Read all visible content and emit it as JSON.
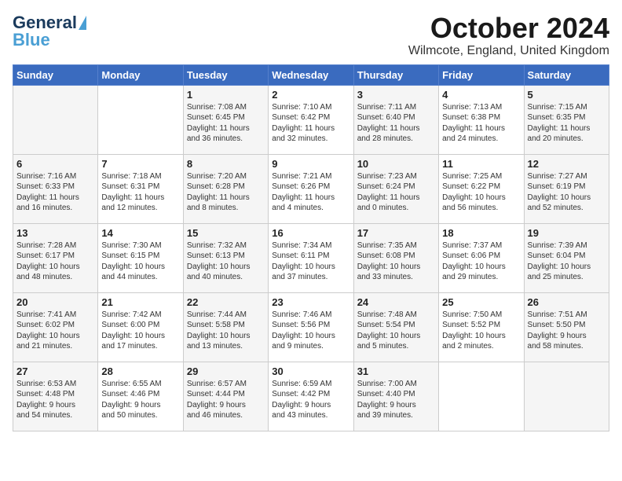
{
  "header": {
    "logo_line1": "General",
    "logo_line2": "Blue",
    "month": "October 2024",
    "location": "Wilmcote, England, United Kingdom"
  },
  "days_of_week": [
    "Sunday",
    "Monday",
    "Tuesday",
    "Wednesday",
    "Thursday",
    "Friday",
    "Saturday"
  ],
  "weeks": [
    [
      {
        "day": "",
        "content": ""
      },
      {
        "day": "",
        "content": ""
      },
      {
        "day": "1",
        "content": "Sunrise: 7:08 AM\nSunset: 6:45 PM\nDaylight: 11 hours\nand 36 minutes."
      },
      {
        "day": "2",
        "content": "Sunrise: 7:10 AM\nSunset: 6:42 PM\nDaylight: 11 hours\nand 32 minutes."
      },
      {
        "day": "3",
        "content": "Sunrise: 7:11 AM\nSunset: 6:40 PM\nDaylight: 11 hours\nand 28 minutes."
      },
      {
        "day": "4",
        "content": "Sunrise: 7:13 AM\nSunset: 6:38 PM\nDaylight: 11 hours\nand 24 minutes."
      },
      {
        "day": "5",
        "content": "Sunrise: 7:15 AM\nSunset: 6:35 PM\nDaylight: 11 hours\nand 20 minutes."
      }
    ],
    [
      {
        "day": "6",
        "content": "Sunrise: 7:16 AM\nSunset: 6:33 PM\nDaylight: 11 hours\nand 16 minutes."
      },
      {
        "day": "7",
        "content": "Sunrise: 7:18 AM\nSunset: 6:31 PM\nDaylight: 11 hours\nand 12 minutes."
      },
      {
        "day": "8",
        "content": "Sunrise: 7:20 AM\nSunset: 6:28 PM\nDaylight: 11 hours\nand 8 minutes."
      },
      {
        "day": "9",
        "content": "Sunrise: 7:21 AM\nSunset: 6:26 PM\nDaylight: 11 hours\nand 4 minutes."
      },
      {
        "day": "10",
        "content": "Sunrise: 7:23 AM\nSunset: 6:24 PM\nDaylight: 11 hours\nand 0 minutes."
      },
      {
        "day": "11",
        "content": "Sunrise: 7:25 AM\nSunset: 6:22 PM\nDaylight: 10 hours\nand 56 minutes."
      },
      {
        "day": "12",
        "content": "Sunrise: 7:27 AM\nSunset: 6:19 PM\nDaylight: 10 hours\nand 52 minutes."
      }
    ],
    [
      {
        "day": "13",
        "content": "Sunrise: 7:28 AM\nSunset: 6:17 PM\nDaylight: 10 hours\nand 48 minutes."
      },
      {
        "day": "14",
        "content": "Sunrise: 7:30 AM\nSunset: 6:15 PM\nDaylight: 10 hours\nand 44 minutes."
      },
      {
        "day": "15",
        "content": "Sunrise: 7:32 AM\nSunset: 6:13 PM\nDaylight: 10 hours\nand 40 minutes."
      },
      {
        "day": "16",
        "content": "Sunrise: 7:34 AM\nSunset: 6:11 PM\nDaylight: 10 hours\nand 37 minutes."
      },
      {
        "day": "17",
        "content": "Sunrise: 7:35 AM\nSunset: 6:08 PM\nDaylight: 10 hours\nand 33 minutes."
      },
      {
        "day": "18",
        "content": "Sunrise: 7:37 AM\nSunset: 6:06 PM\nDaylight: 10 hours\nand 29 minutes."
      },
      {
        "day": "19",
        "content": "Sunrise: 7:39 AM\nSunset: 6:04 PM\nDaylight: 10 hours\nand 25 minutes."
      }
    ],
    [
      {
        "day": "20",
        "content": "Sunrise: 7:41 AM\nSunset: 6:02 PM\nDaylight: 10 hours\nand 21 minutes."
      },
      {
        "day": "21",
        "content": "Sunrise: 7:42 AM\nSunset: 6:00 PM\nDaylight: 10 hours\nand 17 minutes."
      },
      {
        "day": "22",
        "content": "Sunrise: 7:44 AM\nSunset: 5:58 PM\nDaylight: 10 hours\nand 13 minutes."
      },
      {
        "day": "23",
        "content": "Sunrise: 7:46 AM\nSunset: 5:56 PM\nDaylight: 10 hours\nand 9 minutes."
      },
      {
        "day": "24",
        "content": "Sunrise: 7:48 AM\nSunset: 5:54 PM\nDaylight: 10 hours\nand 5 minutes."
      },
      {
        "day": "25",
        "content": "Sunrise: 7:50 AM\nSunset: 5:52 PM\nDaylight: 10 hours\nand 2 minutes."
      },
      {
        "day": "26",
        "content": "Sunrise: 7:51 AM\nSunset: 5:50 PM\nDaylight: 9 hours\nand 58 minutes."
      }
    ],
    [
      {
        "day": "27",
        "content": "Sunrise: 6:53 AM\nSunset: 4:48 PM\nDaylight: 9 hours\nand 54 minutes."
      },
      {
        "day": "28",
        "content": "Sunrise: 6:55 AM\nSunset: 4:46 PM\nDaylight: 9 hours\nand 50 minutes."
      },
      {
        "day": "29",
        "content": "Sunrise: 6:57 AM\nSunset: 4:44 PM\nDaylight: 9 hours\nand 46 minutes."
      },
      {
        "day": "30",
        "content": "Sunrise: 6:59 AM\nSunset: 4:42 PM\nDaylight: 9 hours\nand 43 minutes."
      },
      {
        "day": "31",
        "content": "Sunrise: 7:00 AM\nSunset: 4:40 PM\nDaylight: 9 hours\nand 39 minutes."
      },
      {
        "day": "",
        "content": ""
      },
      {
        "day": "",
        "content": ""
      }
    ]
  ]
}
